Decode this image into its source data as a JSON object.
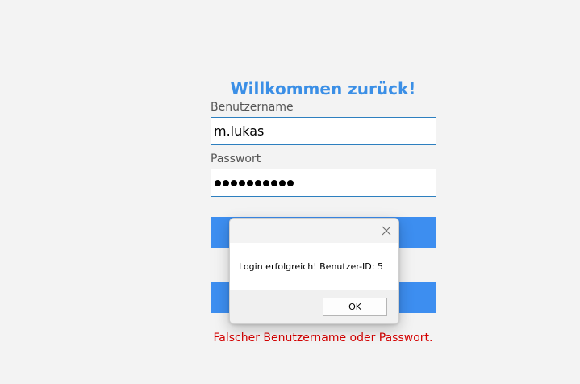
{
  "login": {
    "title": "Willkommen zurück!",
    "username_label": "Benutzername",
    "username_value": "m.lukas",
    "password_label": "Passwort",
    "password_length": 10,
    "error_text": "Falscher Benutzername oder Passwort.",
    "accent_color": "#3b8fe6",
    "button_color": "#3d8ef0",
    "error_color": "#d40000"
  },
  "dialog": {
    "message": "Login erfolgreich! Benutzer-ID: 5",
    "ok_label": "OK",
    "close_icon": "close-icon"
  }
}
